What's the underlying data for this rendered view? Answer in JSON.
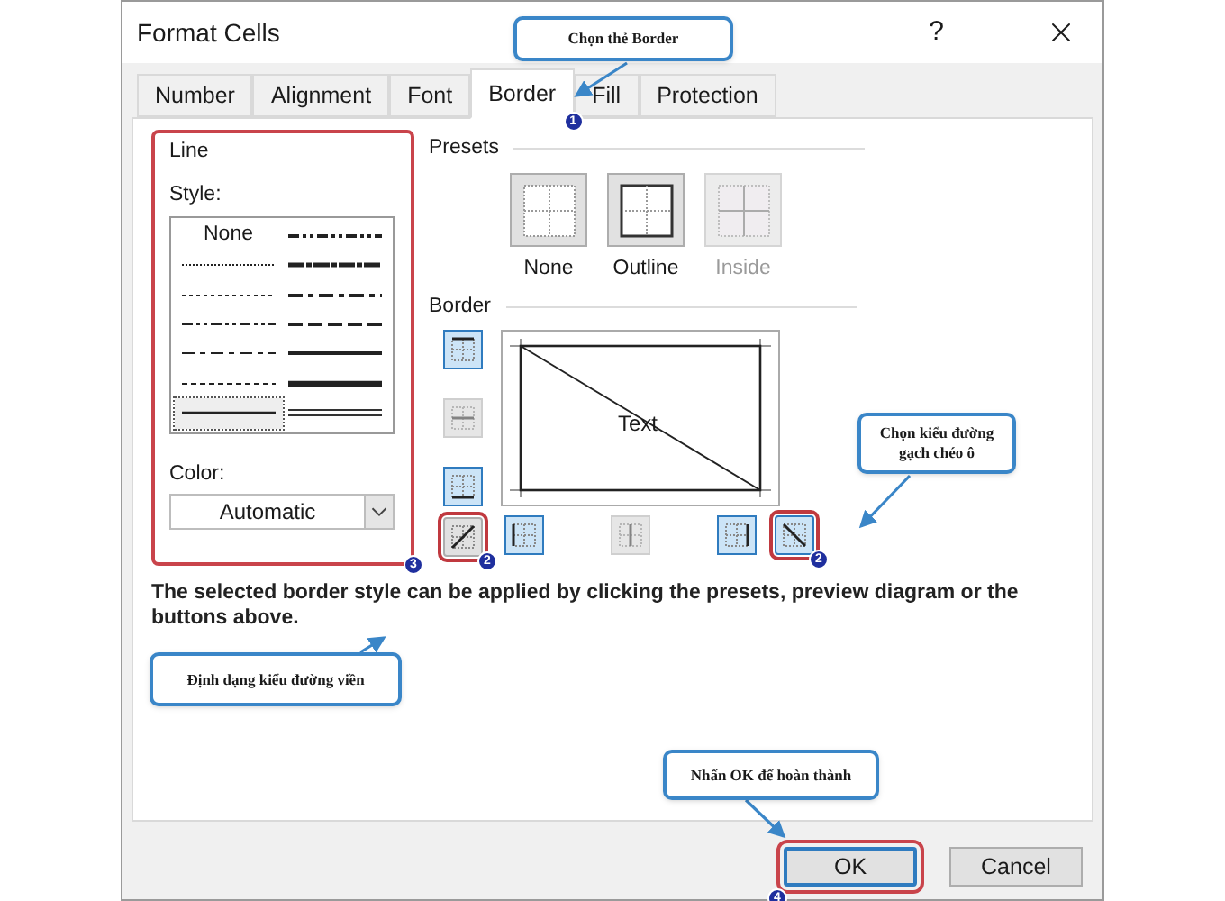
{
  "window": {
    "title": "Format Cells",
    "help": "?"
  },
  "tabs": [
    {
      "label": "Number",
      "selected": false
    },
    {
      "label": "Alignment",
      "selected": false
    },
    {
      "label": "Font",
      "selected": false
    },
    {
      "label": "Border",
      "selected": true,
      "badge": "1"
    },
    {
      "label": "Fill",
      "selected": false
    },
    {
      "label": "Protection",
      "selected": false
    }
  ],
  "line": {
    "title": "Line",
    "highlighted": true,
    "badge": "3",
    "style_label": "Style:",
    "color_label": "Color:",
    "color_value": "Automatic",
    "styles": [
      {
        "kind": "none",
        "label": "None",
        "selected": false
      },
      {
        "kind": "medium-dash-dot-dot",
        "selected": false
      },
      {
        "kind": "hair",
        "selected": false
      },
      {
        "kind": "slanted",
        "selected": false
      },
      {
        "kind": "dotted",
        "selected": false
      },
      {
        "kind": "medium-dash-dot",
        "selected": false
      },
      {
        "kind": "dash-dot-dot",
        "selected": false
      },
      {
        "kind": "medium-dashed",
        "selected": false
      },
      {
        "kind": "dash-dot",
        "selected": false
      },
      {
        "kind": "medium",
        "selected": false
      },
      {
        "kind": "dashed",
        "selected": false
      },
      {
        "kind": "thick",
        "selected": false
      },
      {
        "kind": "thin",
        "selected": true
      },
      {
        "kind": "double",
        "selected": false
      }
    ]
  },
  "presets": {
    "title": "Presets",
    "items": [
      {
        "kind": "none",
        "label": "None",
        "disabled": false
      },
      {
        "kind": "outline",
        "label": "Outline",
        "disabled": false
      },
      {
        "kind": "inside",
        "label": "Inside",
        "disabled": true
      }
    ]
  },
  "border": {
    "title": "Border",
    "preview_text": "Text",
    "side_buttons": [
      {
        "kind": "top",
        "on": true
      },
      {
        "kind": "middle",
        "disabled": true
      },
      {
        "kind": "bottom",
        "on": true
      },
      {
        "kind": "diag-up",
        "on": false,
        "highlighted": true,
        "badge": "2"
      }
    ],
    "bottom_buttons": [
      {
        "kind": "left",
        "on": true
      },
      {
        "kind": "center",
        "disabled": true
      },
      {
        "kind": "right",
        "on": true
      },
      {
        "kind": "diag-down",
        "on": true,
        "highlighted": true,
        "badge": "2"
      }
    ]
  },
  "hint": "The selected border style can be applied by clicking the presets, preview diagram or the buttons above.",
  "buttons": [
    {
      "label": "OK",
      "default": true,
      "highlighted": true,
      "badge": "4"
    },
    {
      "label": "Cancel",
      "default": false
    }
  ],
  "callouts": [
    {
      "kind": "tab",
      "text": "Chọn thẻ Border"
    },
    {
      "kind": "diagonal",
      "text": "Chọn kiểu đường gạch chéo ô"
    },
    {
      "kind": "line",
      "text": "Định dạng kiểu đường viền"
    },
    {
      "kind": "ok",
      "text": "Nhấn OK để hoàn thành"
    }
  ]
}
